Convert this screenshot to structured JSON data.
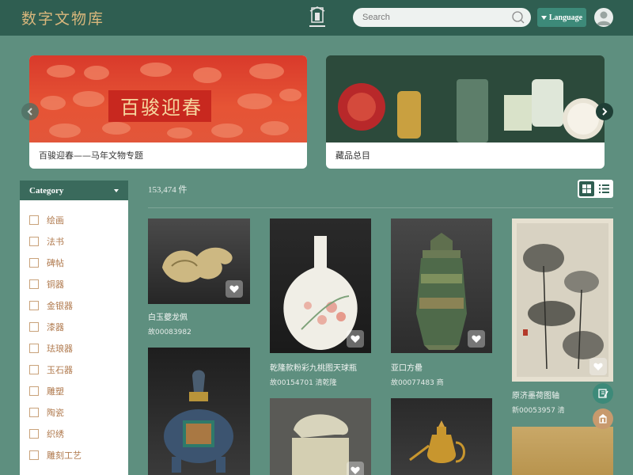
{
  "header": {
    "logo": "数字文物库",
    "search_placeholder": "Search",
    "language_label": "Language"
  },
  "banners": [
    {
      "title_art": "百骏迎春",
      "caption": "百骏迎春——马年文物专题"
    },
    {
      "caption": "藏品总目"
    }
  ],
  "sidebar": {
    "heading": "Category",
    "items": [
      "绘画",
      "法书",
      "碑帖",
      "铜器",
      "金银器",
      "漆器",
      "珐琅器",
      "玉石器",
      "雕塑",
      "陶瓷",
      "织绣",
      "雕刻工艺"
    ]
  },
  "results": {
    "count": "153,474 件"
  },
  "cards": [
    {
      "title": "白玉夔龙佩",
      "sub": "故00083982"
    },
    {
      "title": "乾隆款粉彩九桃图天球瓶",
      "sub": "故00154701  清乾隆"
    },
    {
      "title": "亚口方罍",
      "sub": "故00077483  商"
    },
    {
      "title": "原济墨荷图轴",
      "sub": "新00053957  清"
    }
  ],
  "icons": {
    "search": "search-icon",
    "language_caret": "caret-down-icon",
    "avatar": "user-icon",
    "prev": "chevron-left-icon",
    "next": "chevron-right-icon",
    "grid_view": "grid-view-icon",
    "list_view": "list-view-icon",
    "favorite": "heart-icon",
    "feedback": "edit-icon",
    "museum": "museum-icon"
  },
  "colors": {
    "header_bg": "#2f5e51",
    "page_bg": "#5e8f7f",
    "accent": "#3d8a79",
    "logo_gold": "#d9b77c",
    "category_text": "#b07a4e"
  }
}
